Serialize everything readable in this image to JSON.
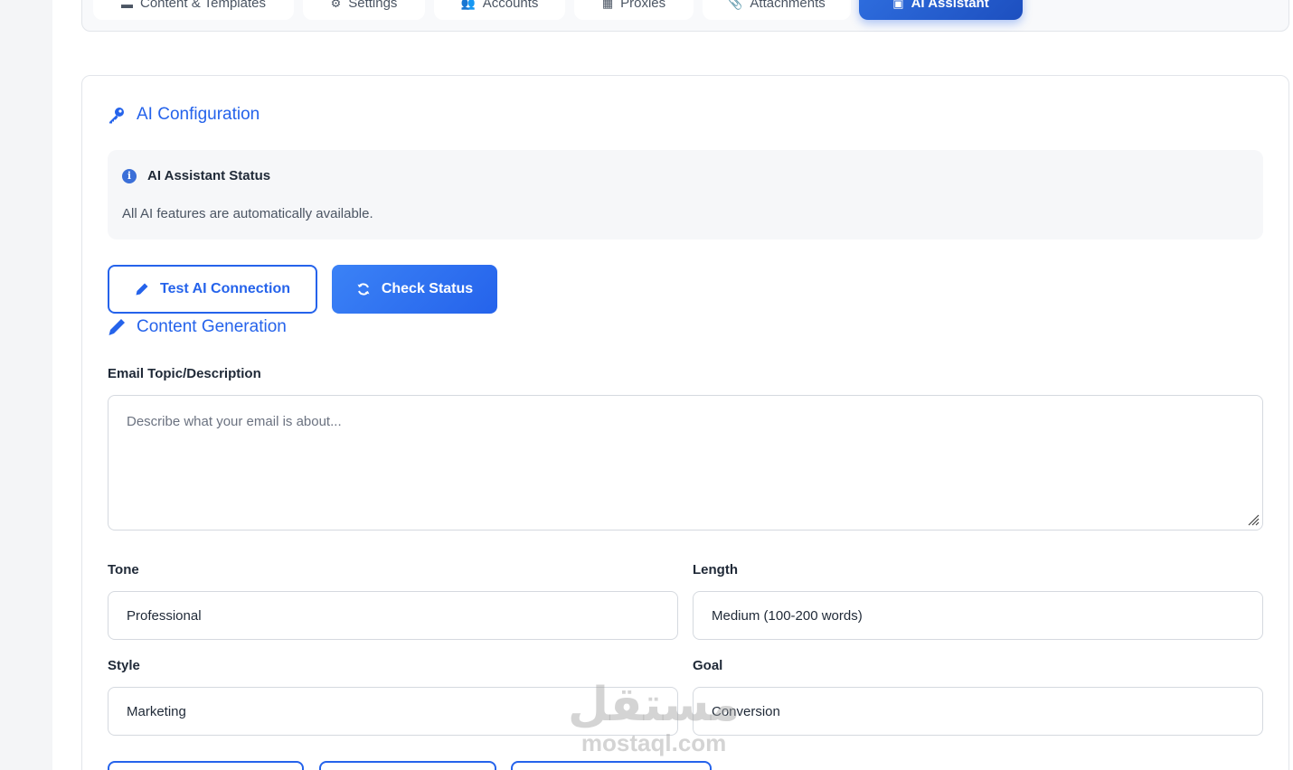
{
  "tabs": [
    {
      "label": "Content & Templates",
      "icon": "document-icon"
    },
    {
      "label": "Settings",
      "icon": "gear-icon"
    },
    {
      "label": "Accounts",
      "icon": "users-icon"
    },
    {
      "label": "Proxies",
      "icon": "grid-icon"
    },
    {
      "label": "Attachments",
      "icon": "paperclip-icon"
    },
    {
      "label": "AI Assistant",
      "icon": "robot-icon",
      "active": true
    }
  ],
  "ai_config": {
    "title": "AI Configuration",
    "status_title": "AI Assistant Status",
    "status_text": "All AI features are automatically available.",
    "test_button": "Test AI Connection",
    "check_button": "Check Status"
  },
  "content_generation": {
    "title": "Content Generation",
    "topic_label": "Email Topic/Description",
    "topic_placeholder": "Describe what your email is about...",
    "topic_value": "",
    "tone_label": "Tone",
    "tone_value": "Professional",
    "length_label": "Length",
    "length_value": "Medium (100-200 words)",
    "style_label": "Style",
    "style_value": "Marketing",
    "goal_label": "Goal",
    "goal_value": "Conversion"
  },
  "watermark": {
    "arabic": "مستقل",
    "latin": "mostaql.com"
  },
  "colors": {
    "accent": "#2563eb",
    "active_tab": "#1d4fbf",
    "status_bg": "#f6f7f9"
  }
}
